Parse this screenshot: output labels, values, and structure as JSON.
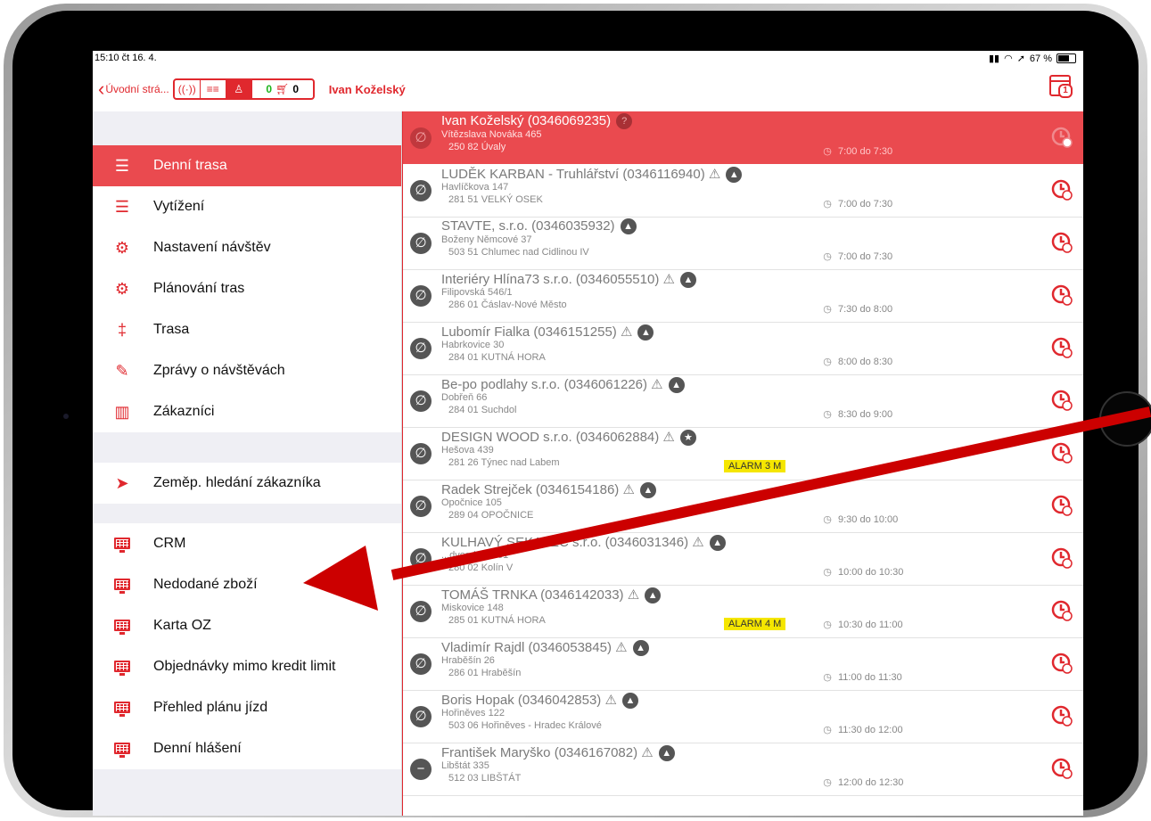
{
  "status": {
    "time": "15:10  čt 16. 4.",
    "battery": "67 %"
  },
  "nav": {
    "back_label": "Úvodní strá...",
    "seg_signal": "((·))",
    "seg_list": "≡≡",
    "seg_user": "♙",
    "cart_left": "0",
    "cart_right": "0",
    "title": "Ivan Koželský",
    "calendar_badge": "1"
  },
  "menu": {
    "items": [
      {
        "label": "Denní trasa",
        "icon": "list-icon"
      },
      {
        "label": "Vytížení",
        "icon": "list-icon"
      },
      {
        "label": "Nastavení návštěv",
        "icon": "gear-network-icon"
      },
      {
        "label": "Plánování tras",
        "icon": "signpost-gear-icon"
      },
      {
        "label": "Trasa",
        "icon": "signpost-icon"
      },
      {
        "label": "Zprávy o návštěvách",
        "icon": "note-edit-icon"
      },
      {
        "label": "Zákazníci",
        "icon": "bar-chart-icon"
      },
      {
        "label": "Zeměp. hledání zákazníka",
        "icon": "location-arrow-icon"
      },
      {
        "label": "CRM",
        "icon": "monitor-icon"
      },
      {
        "label": "Nedodané zboží",
        "icon": "monitor-icon"
      },
      {
        "label": "Karta OZ",
        "icon": "monitor-icon"
      },
      {
        "label": "Objednávky mimo kredit limit",
        "icon": "monitor-icon"
      },
      {
        "label": "Přehled plánu jízd",
        "icon": "monitor-icon"
      },
      {
        "label": "Denní hlášení",
        "icon": "monitor-icon"
      }
    ]
  },
  "visits": [
    {
      "name": "Ivan Koželský (0346069235)",
      "street": "Vítězslava Nováka 465",
      "city": "250 82 Úvaly",
      "time": "7:00 do 7:30",
      "badge": "?",
      "alarm": "",
      "status": "∅"
    },
    {
      "name": "LUDĚK KARBAN - Truhlářství (0346116940) ⚠",
      "street": "Havlíčkova 147",
      "city": "281 51 VELKÝ OSEK",
      "time": "7:00 do 7:30",
      "badge": "▲",
      "alarm": "",
      "status": "∅"
    },
    {
      "name": "STAVTE, s.r.o. (0346035932)",
      "street": "Boženy Němcové 37",
      "city": "503 51 Chlumec nad Cidlinou IV",
      "time": "7:00 do 7:30",
      "badge": "▲",
      "alarm": "",
      "status": "∅"
    },
    {
      "name": "Interiéry Hlína73 s.r.o. (0346055510) ⚠",
      "street": "Filipovská 546/1",
      "city": "286 01 Čáslav-Nové Město",
      "time": "7:30 do 8:00",
      "badge": "▲",
      "alarm": "",
      "status": "∅"
    },
    {
      "name": "Lubomír Fialka (0346151255) ⚠",
      "street": "Habrkovice 30",
      "city": "284 01 KUTNÁ HORA",
      "time": "8:00 do 8:30",
      "badge": "▲",
      "alarm": "",
      "status": "∅"
    },
    {
      "name": "Be-po podlahy s.r.o. (0346061226) ⚠",
      "street": "Dobřeň 66",
      "city": "284 01 Suchdol",
      "time": "8:30 do 9:00",
      "badge": "▲",
      "alarm": "",
      "status": "∅"
    },
    {
      "name": "DESIGN WOOD s.r.o. (0346062884) ⚠",
      "street": "Hešova 439",
      "city": "281 26 Týnec nad Labem",
      "time": "",
      "badge": "★",
      "alarm": "ALARM 3 M",
      "status": "∅"
    },
    {
      "name": "Radek Strejček (0346154186) ⚠",
      "street": "Opočnice 105",
      "city": "289 04 OPOČNICE",
      "time": "9:30 do 10:00",
      "badge": "▲",
      "alarm": "",
      "status": "∅"
    },
    {
      "name": "KULHAVÝ SEKAVEC s.r.o. (0346031346) ⚠",
      "street": "...dvorská 1401",
      "city": "280 02 Kolín V",
      "time": "10:00 do 10:30",
      "badge": "▲",
      "alarm": "",
      "status": "∅"
    },
    {
      "name": "TOMÁŠ TRNKA (0346142033) ⚠",
      "street": "Miskovice 148",
      "city": "285 01 KUTNÁ HORA",
      "time": "10:30 do 11:00",
      "badge": "▲",
      "alarm": "ALARM 4 M",
      "status": "∅"
    },
    {
      "name": "Vladimír Rajdl (0346053845) ⚠",
      "street": "Hraběšín 26",
      "city": "286 01 Hraběšín",
      "time": "11:00 do 11:30",
      "badge": "▲",
      "alarm": "",
      "status": "∅"
    },
    {
      "name": "Boris Hopak (0346042853) ⚠",
      "street": "Hořiněves 122",
      "city": "503 06 Hořiněves - Hradec Králové",
      "time": "11:30 do 12:00",
      "badge": "▲",
      "alarm": "",
      "status": "∅"
    },
    {
      "name": "František Maryško (0346167082) ⚠",
      "street": "Libštát 335",
      "city": "512 03 LIBŠTÁT",
      "time": "12:00 do 12:30",
      "badge": "▲",
      "alarm": "",
      "status": "−"
    }
  ],
  "colors": {
    "accent": "#e0282e",
    "selected_row": "#ea4a4f",
    "alarm": "#f5e600",
    "arrow": "#cc0000"
  }
}
